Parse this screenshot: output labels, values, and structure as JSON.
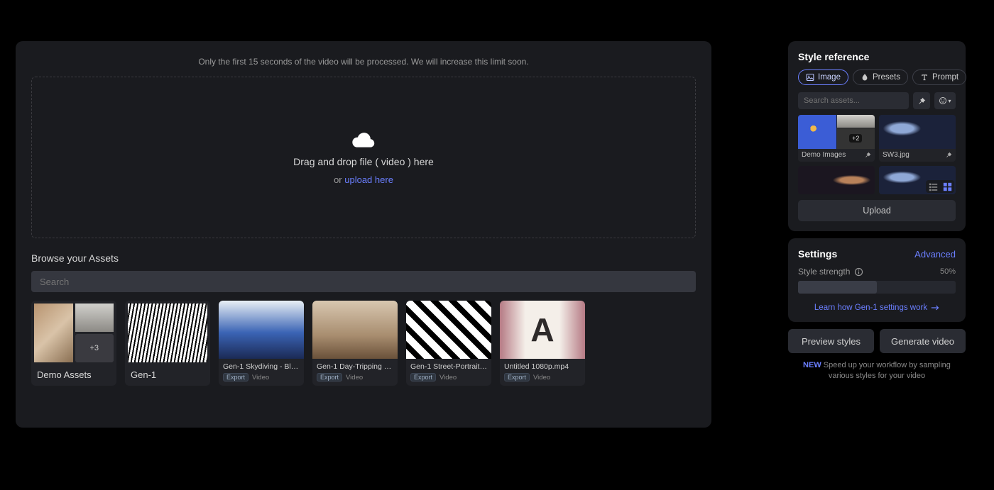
{
  "main": {
    "limit_note": "Only the first 15 seconds of the video will be processed. We will increase this limit soon.",
    "dropzone": {
      "line1": "Drag and drop file ( video ) here",
      "or": "or ",
      "link": "upload here"
    },
    "browse_label": "Browse your Assets",
    "search_placeholder": "Search",
    "folders": [
      {
        "title": "Demo Assets",
        "more": "+3"
      },
      {
        "title": "Gen-1",
        "more": ""
      }
    ],
    "videos": [
      {
        "title": "Gen-1 Skydiving - Blue ...",
        "tag": "Export",
        "type": "Video"
      },
      {
        "title": "Gen-1 Day-Tripping - W...",
        "tag": "Export",
        "type": "Video"
      },
      {
        "title": "Gen-1 Street-Portrait - ...",
        "tag": "Export",
        "type": "Video"
      },
      {
        "title": "Untitled 1080p.mp4",
        "tag": "Export",
        "type": "Video"
      }
    ]
  },
  "style_ref": {
    "title": "Style reference",
    "tabs": {
      "image": "Image",
      "presets": "Presets",
      "prompt": "Prompt"
    },
    "search_placeholder": "Search assets...",
    "items": [
      {
        "label": "Demo Images",
        "badge": "+2",
        "pinned": true
      },
      {
        "label": "SW3.jpg",
        "badge": "",
        "pinned": true
      },
      {
        "label": "",
        "badge": "",
        "pinned": false
      },
      {
        "label": "",
        "badge": "",
        "pinned": false
      }
    ],
    "upload": "Upload"
  },
  "settings": {
    "title": "Settings",
    "advanced": "Advanced",
    "strength_label": "Style strength",
    "strength_value": "50%",
    "learn": "Learn how Gen-1 settings work"
  },
  "actions": {
    "preview": "Preview styles",
    "generate": "Generate video"
  },
  "tip": {
    "new": "NEW",
    "text": " Speed up your workflow by sampling various styles for your video"
  }
}
